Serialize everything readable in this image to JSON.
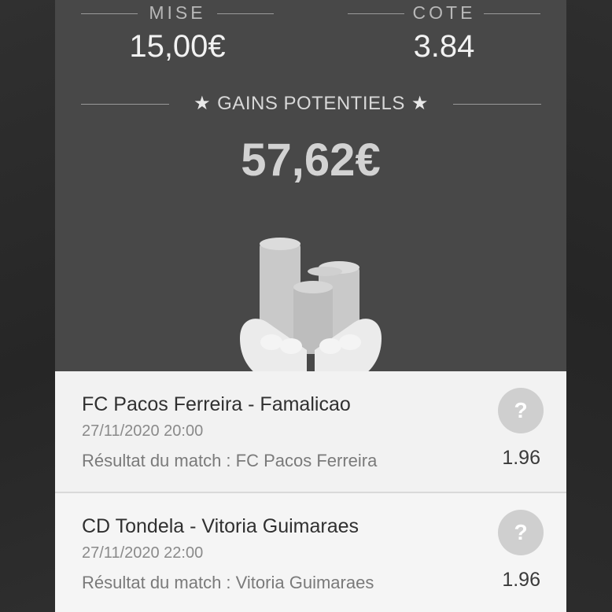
{
  "summary": {
    "mise_label": "MISE",
    "mise_value": "15,00€",
    "cote_label": "COTE",
    "cote_value": "3.84",
    "gains_label": "GAINS POTENTIELS",
    "gains_value": "57,62€",
    "star_icon": "★"
  },
  "bets": [
    {
      "match": "FC Pacos Ferreira - Famalicao",
      "datetime": "27/11/2020 20:00",
      "result": "Résultat du match : FC Pacos Ferreira",
      "odds": "1.96",
      "status_icon": "?"
    },
    {
      "match": "CD Tondela - Vitoria Guimaraes",
      "datetime": "27/11/2020 22:00",
      "result": "Résultat du match : Vitoria Guimaraes",
      "odds": "1.96",
      "status_icon": "?"
    }
  ],
  "colors": {
    "card_background": "#484848",
    "page_background": "#2a2a2a",
    "list_background": "#f2f2f2",
    "status_circle": "#cfcfcf"
  }
}
